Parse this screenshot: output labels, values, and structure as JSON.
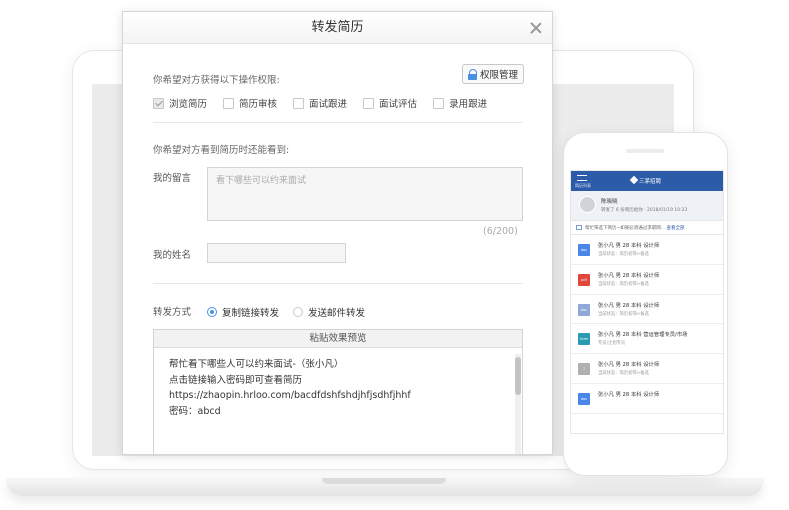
{
  "dialog": {
    "title": "转发简历",
    "permission_prompt": "你希望对方获得以下操作权限:",
    "permission_button": "权限管理",
    "permissions": [
      {
        "label": "浏览简历",
        "checked": true
      },
      {
        "label": "简历审核",
        "checked": false
      },
      {
        "label": "面试跟进",
        "checked": false
      },
      {
        "label": "面试评估",
        "checked": false
      },
      {
        "label": "录用跟进",
        "checked": false
      }
    ],
    "view_prompt": "你希望对方看到简历时还能看到:",
    "message_label": "我的留言",
    "message_placeholder": "看下哪些可以约来面试",
    "counter": "(6/200)",
    "name_label": "我的姓名",
    "name_value": "",
    "forward_label": "转发方式",
    "forward_options": [
      {
        "label": "复制链接转发",
        "selected": true
      },
      {
        "label": "发送邮件转发",
        "selected": false
      }
    ],
    "preview_title": "粘贴效果预览",
    "preview_lines": [
      "帮忙看下哪些人可以约来面试-（张小凡）",
      "点击链接输入密码即可查看简历",
      "https://zhaopin.hrloo.com/bacdfdshfshdjhfjsdhfjhhf",
      "密码：abcd"
    ]
  },
  "phone": {
    "menu_label": "简历列表",
    "app_title": "三茅招聘",
    "user_name": "陈晓晓",
    "user_sub": "转发了 6 份简历给你 · 2018/01/19 10:23",
    "notice_text": "帮忙筛选下简历~如果必须通过求职网...",
    "notice_link": "查看全部",
    "candidates": [
      {
        "type": "doc",
        "color": "#4a86e8",
        "line1": "张小凡  男  28  本科  设计师",
        "line2": "当前状态：简历初筛>备选"
      },
      {
        "type": "pdf",
        "color": "#e0463a",
        "line1": "张小凡  男  28  本科  设计师",
        "line2": "当前状态：简历初筛>备选"
      },
      {
        "type": "doc",
        "color": "#8fa8d8",
        "line1": "张小凡  男  28  本科  设计师",
        "line2": "当前状态：简历初筛>备选"
      },
      {
        "type": "html",
        "color": "#2a9ab0",
        "line1": "张小凡  男  28  本科  营运管理专员/市场",
        "line2": "专员/企划专员"
      },
      {
        "type": "?",
        "color": "#b0b0b0",
        "line1": "张小凡  男  28  本科  设计师",
        "line2": "当前状态：简历初筛>备选"
      },
      {
        "type": "doc",
        "color": "#4a86e8",
        "line1": "张小凡  男  28  本科  设计师",
        "line2": ""
      }
    ]
  }
}
